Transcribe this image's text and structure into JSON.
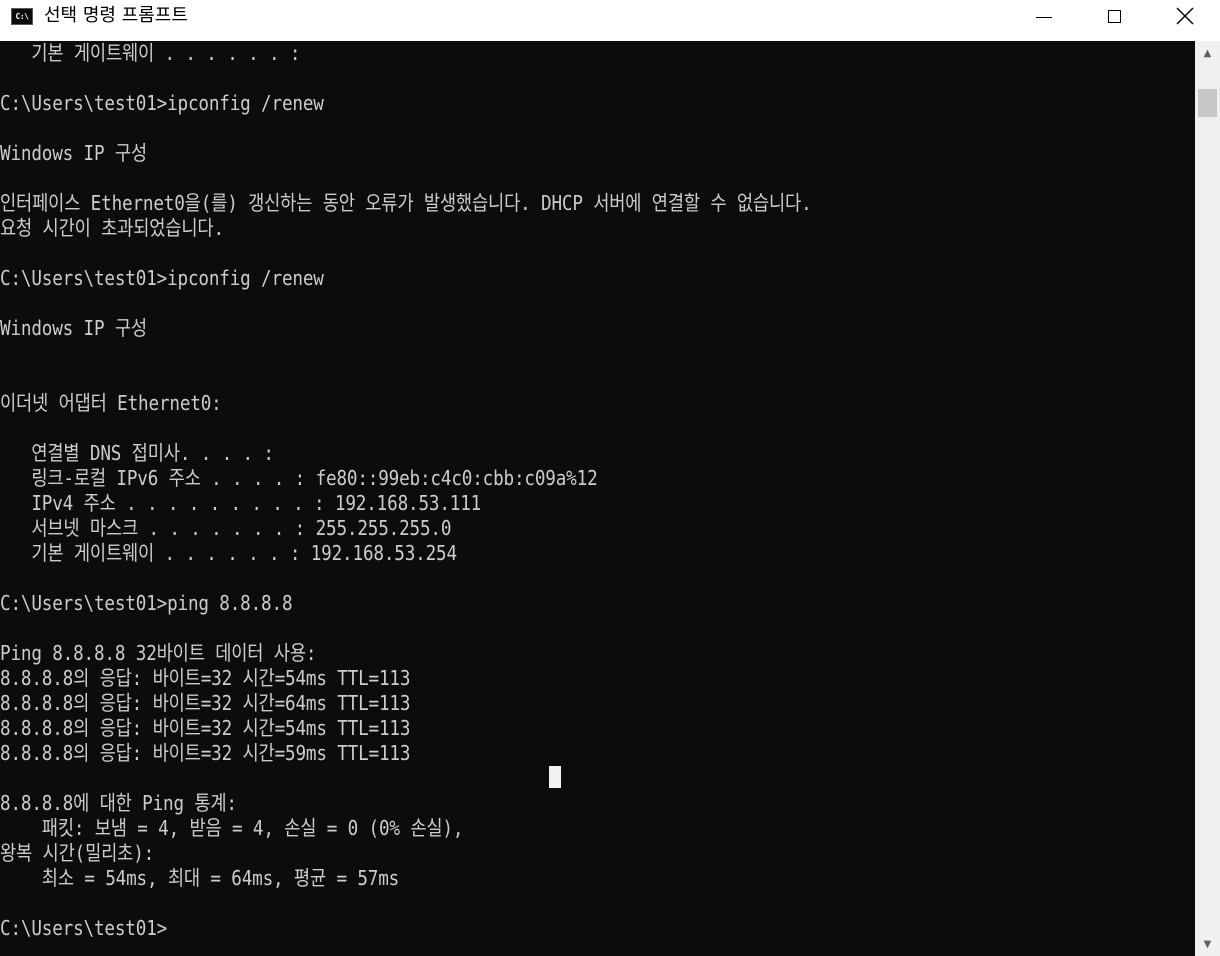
{
  "window": {
    "title": "선택 명령 프롬프트",
    "icon_label": "C:\\",
    "icon": "terminal-icon",
    "controls": {
      "minimize": "minimize-icon",
      "maximize": "maximize-icon",
      "close": "close-icon"
    }
  },
  "console": {
    "background_color": "#0c0c0c",
    "text_color": "#cccccc",
    "lines": [
      "   기본 게이트웨이 . . . . . . :",
      "",
      "C:\\Users\\test01>ipconfig /renew",
      "",
      "Windows IP 구성",
      "",
      "인터페이스 Ethernet0을(를) 갱신하는 동안 오류가 발생했습니다. DHCP 서버에 연결할 수 없습니다.",
      "요청 시간이 초과되었습니다.",
      "",
      "C:\\Users\\test01>ipconfig /renew",
      "",
      "Windows IP 구성",
      "",
      "",
      "이더넷 어댑터 Ethernet0:",
      "",
      "   연결별 DNS 접미사. . . . :",
      "   링크-로컬 IPv6 주소 . . . . : fe80::99eb:c4c0:cbb:c09a%12",
      "   IPv4 주소 . . . . . . . . . : 192.168.53.111",
      "   서브넷 마스크 . . . . . . . : 255.255.255.0",
      "   기본 게이트웨이 . . . . . . : 192.168.53.254",
      "",
      "C:\\Users\\test01>ping 8.8.8.8",
      "",
      "Ping 8.8.8.8 32바이트 데이터 사용:",
      "8.8.8.8의 응답: 바이트=32 시간=54ms TTL=113",
      "8.8.8.8의 응답: 바이트=32 시간=64ms TTL=113",
      "8.8.8.8의 응답: 바이트=32 시간=54ms TTL=113",
      "8.8.8.8의 응답: 바이트=32 시간=59ms TTL=113",
      "",
      "8.8.8.8에 대한 Ping 통계:",
      "    패킷: 보냄 = 4, 받음 = 4, 손실 = 0 (0% 손실),",
      "왕복 시간(밀리초):",
      "    최소 = 54ms, 최대 = 64ms, 평균 = 57ms",
      "",
      "C:\\Users\\test01>"
    ]
  },
  "scrollbar": {
    "up_arrow": "▲",
    "down_arrow": "▼"
  }
}
